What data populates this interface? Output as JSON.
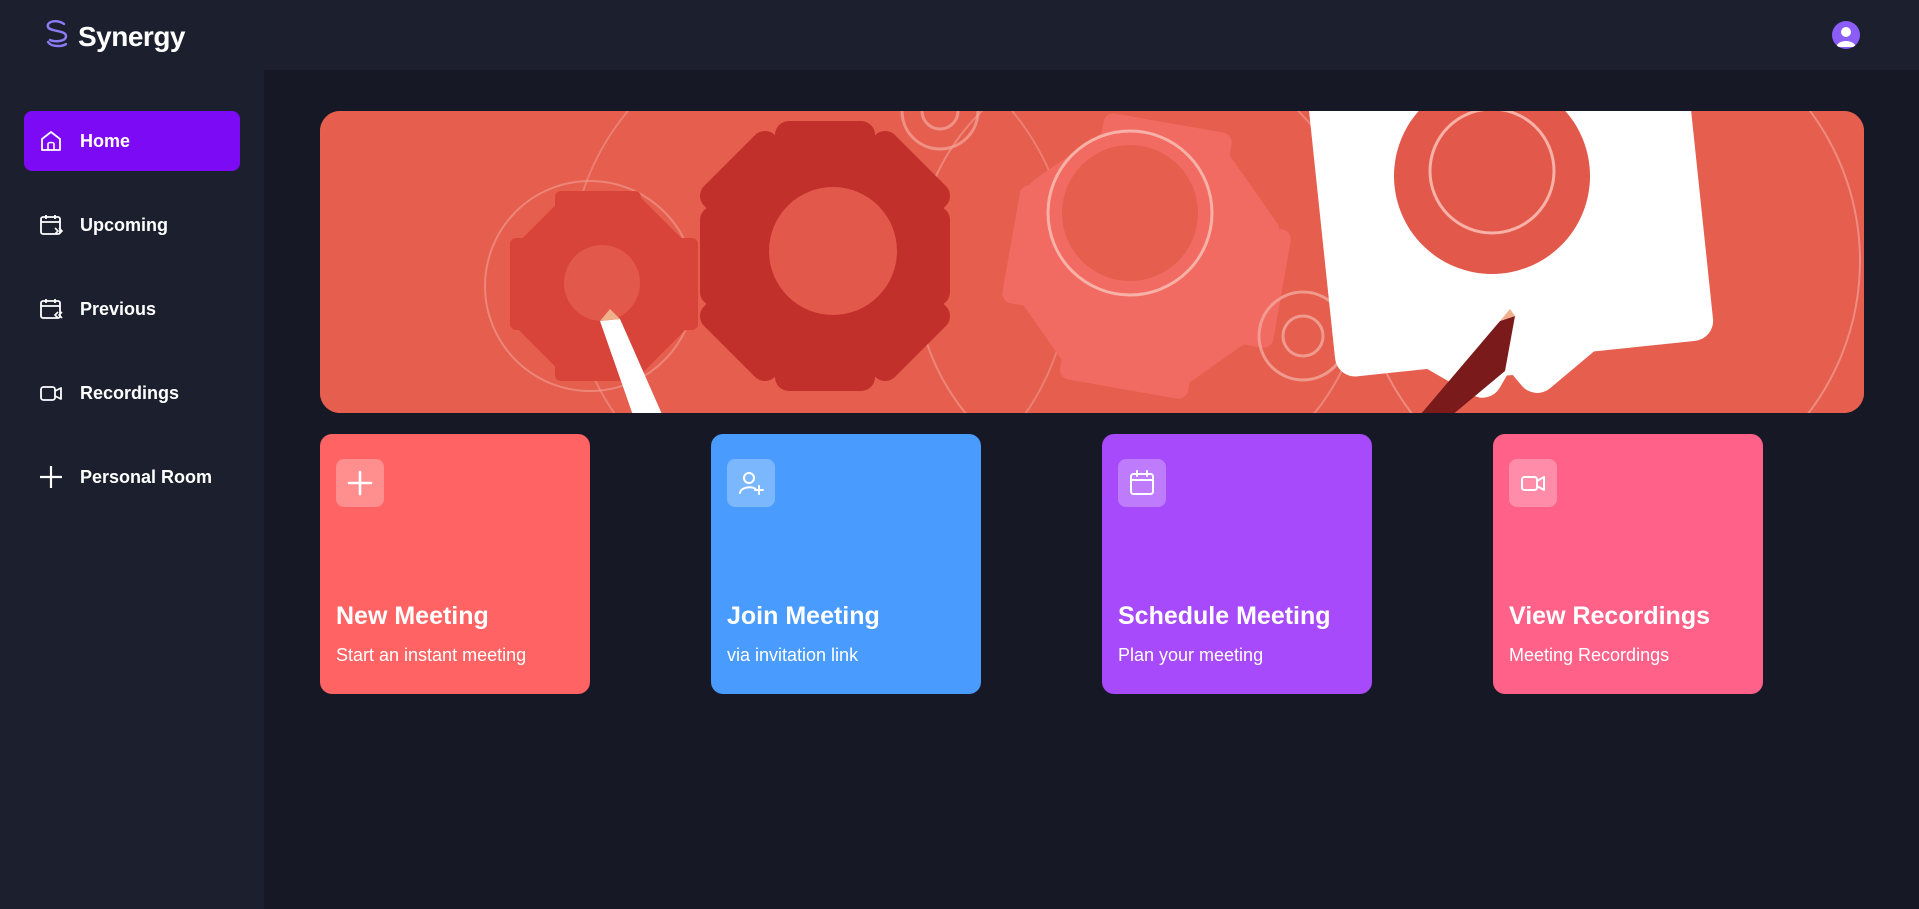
{
  "app": {
    "name": "Synergy"
  },
  "sidebar": {
    "items": [
      {
        "label": "Home",
        "icon": "home-icon",
        "active": true
      },
      {
        "label": "Upcoming",
        "icon": "calendar-upcoming-icon"
      },
      {
        "label": "Previous",
        "icon": "calendar-previous-icon"
      },
      {
        "label": "Recordings",
        "icon": "video-icon"
      },
      {
        "label": "Personal Room",
        "icon": "plus-icon"
      }
    ]
  },
  "cards": [
    {
      "title": "New Meeting",
      "subtitle": "Start an instant meeting",
      "icon": "plus-icon",
      "color": "#ff6363"
    },
    {
      "title": "Join Meeting",
      "subtitle": "via invitation link",
      "icon": "user-plus-icon",
      "color": "#499bfd"
    },
    {
      "title": "Schedule Meeting",
      "subtitle": "Plan your meeting",
      "icon": "calendar-icon",
      "color": "#a64afc"
    },
    {
      "title": "View Recordings",
      "subtitle": "Meeting Recordings",
      "icon": "video-icon",
      "color": "#ff6189"
    }
  ],
  "colors": {
    "topbar": "#1c1f2e",
    "page_background": "#161925",
    "active_nav": "#7c0af5",
    "hero_background": "#e35d4c"
  }
}
